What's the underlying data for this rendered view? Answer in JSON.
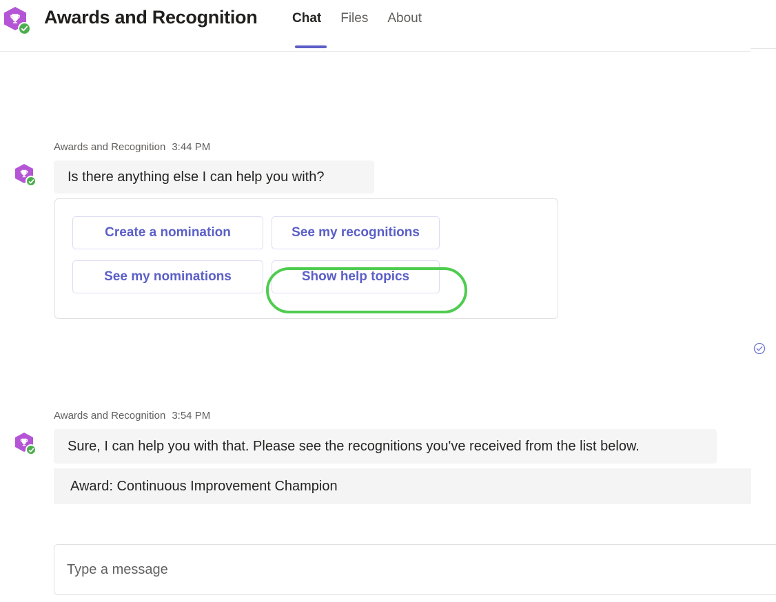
{
  "header": {
    "app_name": "Awards and Recognition",
    "avatar_icon": "trophy-icon",
    "presence_icon": "available-check-icon",
    "presence_color": "#4cae4c",
    "brand_color": "#b455d6",
    "accent_color": "#5b5fc7",
    "tabs": [
      {
        "label": "Chat",
        "active": true
      },
      {
        "label": "Files",
        "active": false
      },
      {
        "label": "About",
        "active": false
      }
    ]
  },
  "conversation": {
    "messages": [
      {
        "sender": "Awards and Recognition",
        "time": "3:44 PM",
        "text": "Is there anything else I can help you with?"
      },
      {
        "sender": "Awards and Recognition",
        "time": "3:54 PM",
        "text": "Sure, I can help you with that. Please see the recognitions you've received from the list below. ",
        "detail": "Award: Continuous Improvement Champion"
      }
    ],
    "suggestion_card": {
      "actions": [
        {
          "label": "Create a nomination",
          "highlighted": false
        },
        {
          "label": "See my recognitions",
          "highlighted": true
        },
        {
          "label": "See my nominations",
          "highlighted": false
        },
        {
          "label": "Show help topics",
          "highlighted": false
        }
      ],
      "highlight_color": "#4fcc4f"
    },
    "read_receipt_icon": "circle-check-icon"
  },
  "composer": {
    "placeholder": "Type a message",
    "value": ""
  }
}
